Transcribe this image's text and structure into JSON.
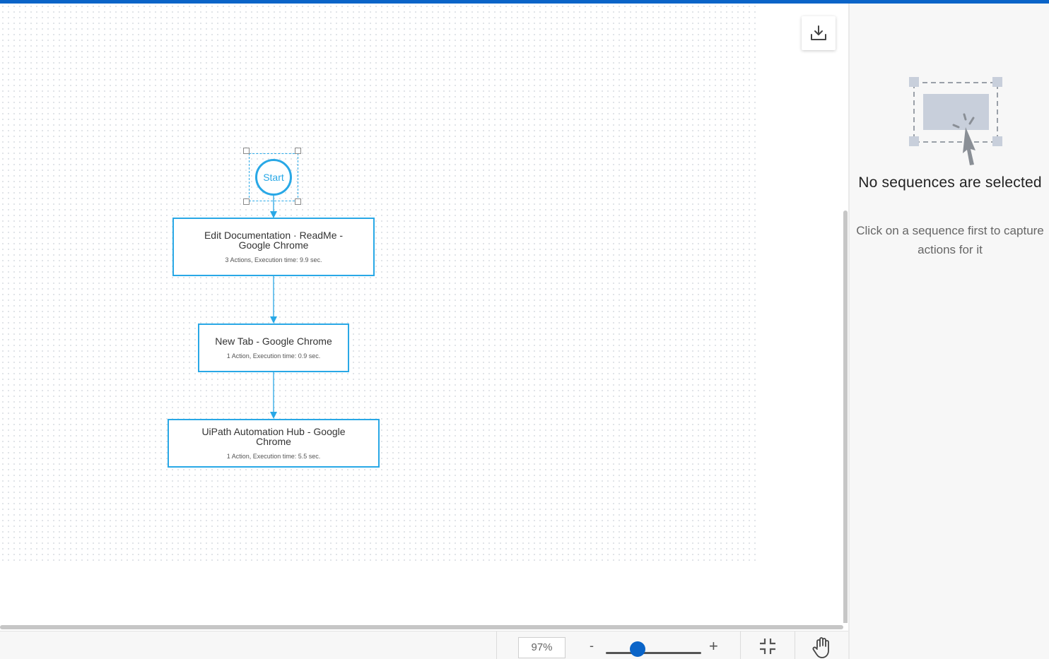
{
  "canvas": {
    "start_label": "Start",
    "sequences": [
      {
        "title": "Edit Documentation · ReadMe - Google Chrome",
        "meta": "3 Actions, Execution time: 9.9 sec."
      },
      {
        "title": "New Tab - Google Chrome",
        "meta": "1 Action, Execution time: 0.9 sec."
      },
      {
        "title": "UiPath Automation Hub - Google Chrome",
        "meta": "1 Action, Execution time: 5.5 sec."
      }
    ],
    "download_icon": "download-icon"
  },
  "toolbar": {
    "zoom_value": "97%",
    "zoom_minus": "-",
    "zoom_plus": "+",
    "zoom_level_fraction": 0.33,
    "fit_icon": "compress-icon",
    "pan_icon": "hand-icon"
  },
  "right_panel": {
    "empty_title": "No sequences are selected",
    "empty_description": "Click on a sequence first to capture actions for it"
  },
  "colors": {
    "accent": "#0a64c8",
    "node_border": "#29a8e6",
    "panel_bg": "#f7f7f7"
  }
}
